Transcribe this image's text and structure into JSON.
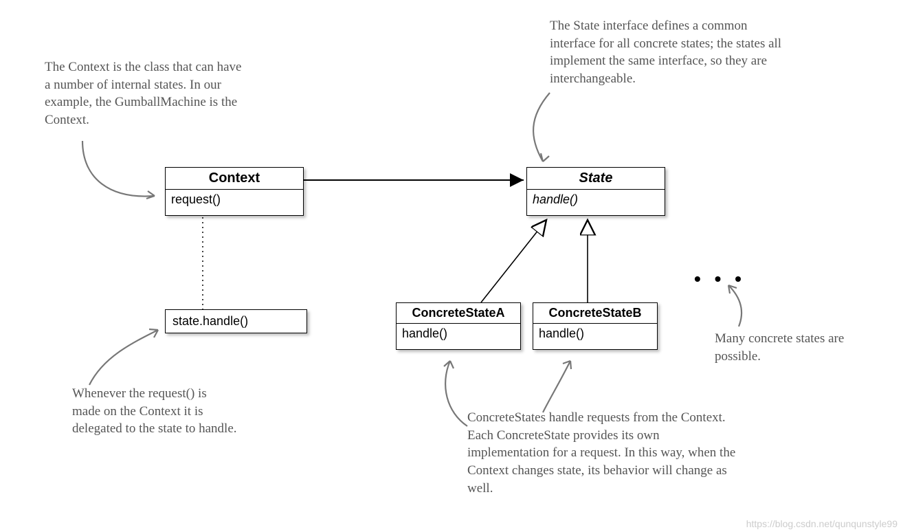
{
  "notes": {
    "context_note": "The Context is the class that can have a number of internal states.  In our example, the GumballMachine is the Context.",
    "state_note": "The State interface defines a common interface for all concrete states;  the states all implement the same interface, so they are interchangeable.",
    "request_note": "Whenever the request() is made on the Context it is delegated to the state to handle.",
    "concrete_note": "ConcreteStates handle requests from the Context. Each ConcreteState provides its own implementation for a request.  In this way, when the Context changes state, its behavior will change as well.",
    "many_note": "Many concrete states are possible."
  },
  "classes": {
    "context": {
      "name": "Context",
      "method": "request()"
    },
    "state": {
      "name": "State",
      "method": "handle()"
    },
    "concreteA": {
      "name": "ConcreteStateA",
      "method": "handle()"
    },
    "concreteB": {
      "name": "ConcreteStateB",
      "method": "handle()"
    }
  },
  "delegate_box": "state.handle()",
  "ellipsis": "• • •",
  "watermark": "https://blog.csdn.net/qunqunstyle99"
}
